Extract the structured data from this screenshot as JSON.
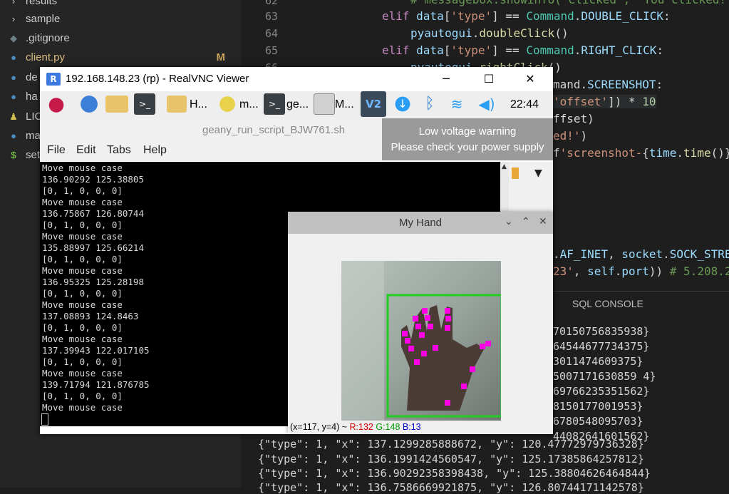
{
  "explorer": {
    "items": [
      {
        "icon": "chevron-right",
        "label": "results",
        "badge": ""
      },
      {
        "icon": "chevron-right",
        "label": "sample",
        "badge": ""
      },
      {
        "icon": "diamond",
        "label": ".gitignore",
        "badge": ""
      },
      {
        "icon": "python",
        "label": "client.py",
        "badge": "M"
      },
      {
        "icon": "python",
        "label": "de",
        "badge": ""
      },
      {
        "icon": "python",
        "label": "ha",
        "badge": ""
      },
      {
        "icon": "license",
        "label": "LIC",
        "badge": ""
      },
      {
        "icon": "python",
        "label": "ma",
        "badge": ""
      },
      {
        "icon": "shell",
        "label": "set",
        "badge": ""
      }
    ]
  },
  "editor": {
    "line_numbers": [
      "62",
      "63",
      "64",
      "65",
      "66"
    ],
    "sql_tab": "SQL CONSOLE"
  },
  "vnc": {
    "title": "192.168.148.23 (rp) - RealVNC Viewer",
    "logo": "R",
    "minimize": "─",
    "maximize": "☐",
    "close": "✕",
    "tasks": [
      "H...",
      "m...",
      "ge...",
      "M..."
    ],
    "clock": "22:44"
  },
  "geany": {
    "title": "geany_run_script_BJW761.sh",
    "menu": [
      "File",
      "Edit",
      "Tabs",
      "Help"
    ]
  },
  "warning": {
    "line1": "Low voltage warning",
    "line2": "Please check your power supply"
  },
  "terminal": {
    "lines": [
      "Move mouse case",
      "136.90292 125.38805",
      "[0, 1, 0, 0, 0]",
      "Move mouse case",
      "136.75867 126.80744",
      "[0, 1, 0, 0, 0]",
      "Move mouse case",
      "135.88997 125.66214",
      "[0, 1, 0, 0, 0]",
      "Move mouse case",
      "136.95325 125.28198",
      "[0, 1, 0, 0, 0]",
      "Move mouse case",
      "137.08893 124.8463",
      "[0, 1, 0, 0, 0]",
      "Move mouse case",
      "137.39943 122.017105",
      "[0, 1, 0, 0, 0]",
      "Move mouse case",
      "139.71794 121.876785",
      "[0, 1, 0, 0, 0]",
      "Move mouse case"
    ]
  },
  "hand_window": {
    "title": "My Hand",
    "status_coords": "(x=117, y=4) ~",
    "r": "R:132",
    "g": "G:148",
    "b": "B:13"
  },
  "output_lines": [
    "70150756835938}",
    "64544677734375}",
    "3011474609375}",
    "5007171630859 4}",
    "69766235351562}",
    "8150177001953}",
    "6780548095703}",
    "44082641601562}",
    "{\"type\": 1, \"x\": 137.1299285888672, \"y\": 120.47772979736328}",
    "{\"type\": 1, \"x\": 136.1991424560547, \"y\": 125.17385864257812}",
    "{\"type\": 1, \"x\": 136.90292358398438, \"y\": 125.38804626464844}",
    "{\"type\": 1, \"x\": 136.7586669921875, \"y\": 126.80744171142578}"
  ],
  "colors": {
    "editor_bg": "#1e1e1e",
    "sidebar_bg": "#252526",
    "green_box": "#22cc22",
    "landmark": "#ff00e6"
  }
}
